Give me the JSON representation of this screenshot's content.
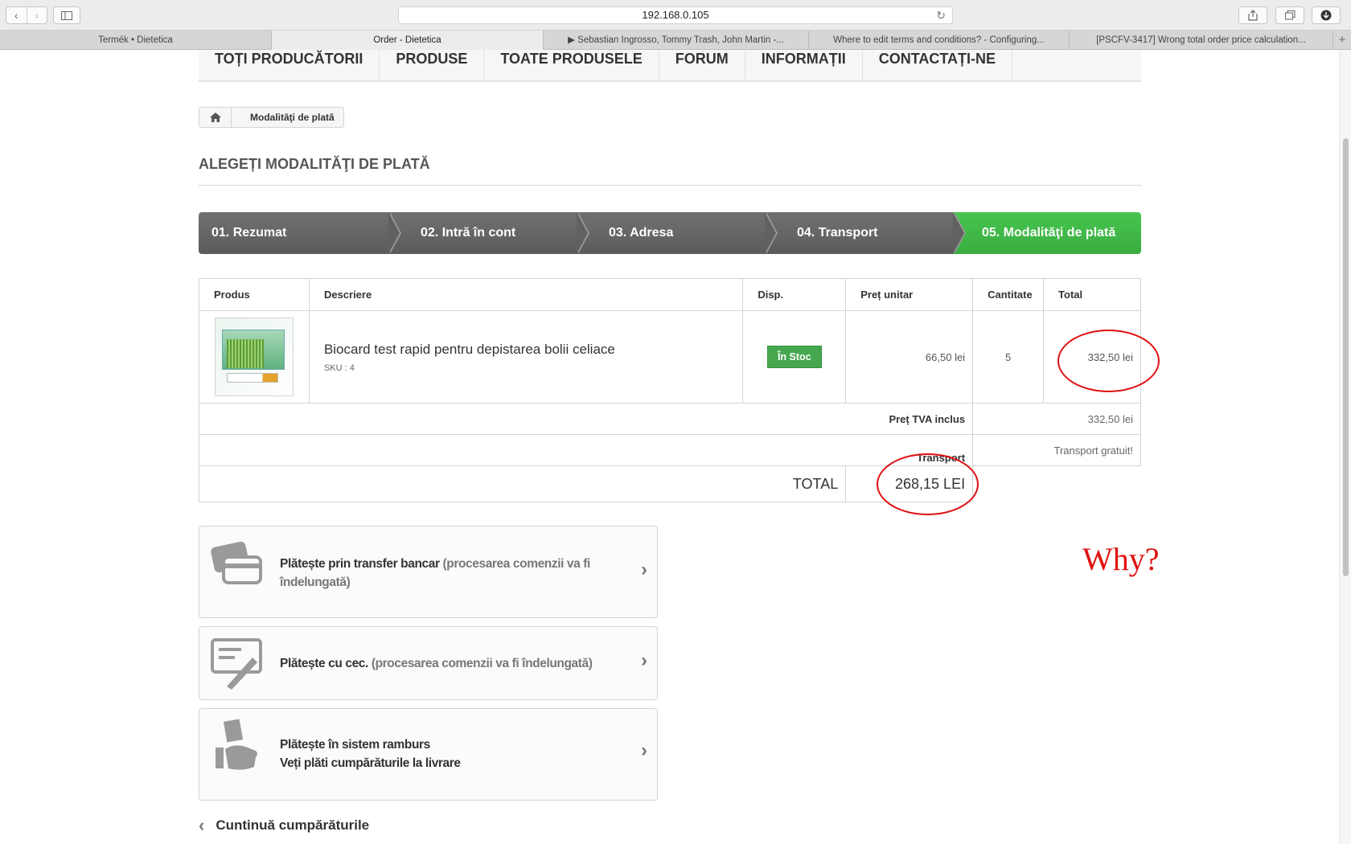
{
  "browser": {
    "url": "192.168.0.105",
    "tabs": [
      "Termék • Dietetica",
      "Order - Dietetica",
      "▶ Sebastian Ingrosso, Tommy Trash, John Martin -...",
      "Where to edit terms and conditions? - Configuring...",
      "[PSCFV-3417] Wrong total order price calculation..."
    ],
    "new_tab": "+"
  },
  "menu": [
    "TOȚI PRODUCĂTORII",
    "PRODUSE",
    "TOATE PRODUSELE",
    "FORUM",
    "INFORMAȚII",
    "CONTACTAȚI-NE"
  ],
  "breadcrumb": {
    "current": "Modalităţi de plată"
  },
  "heading": "ALEGEȚI MODALITĂŢI DE PLATĂ",
  "steps": [
    "01. Rezumat",
    "02. Intră în cont",
    "03. Adresa",
    "04. Transport",
    "05. Modalităţi de plată"
  ],
  "table": {
    "headers": [
      "Produs",
      "Descriere",
      "Disp.",
      "Preț unitar",
      "Cantitate",
      "Total"
    ],
    "row": {
      "name": "Biocard test rapid pentru depistarea bolii celiace",
      "sku": "SKU : 4",
      "stock": "În Stoc",
      "unit_price": "66,50 lei",
      "qty": "5",
      "total": "332,50 lei"
    },
    "vat_label": "Preț TVA inclus",
    "vat_value": "332,50 lei",
    "transport_label": "Transport",
    "transport_value": "Transport gratuit!",
    "total_label": "TOTAL",
    "total_value": "268,15 LEI"
  },
  "payments": [
    {
      "bold": "Plătește prin transfer bancar",
      "muted": "(procesarea comenzii va fi îndelungată)"
    },
    {
      "bold": "Plătește cu cec.",
      "muted": "(procesarea comenzii va fi îndelungată)"
    },
    {
      "bold": "Plătește în sistem ramburs",
      "line2": "Veți plăti cumpărăturile la livrare"
    }
  ],
  "continue": "Cuntinuă cumpărăturile",
  "annotation": "Why?",
  "colors": {
    "step_active": "#46b94c",
    "stock": "#46a74e",
    "annotation": "#e01010"
  }
}
